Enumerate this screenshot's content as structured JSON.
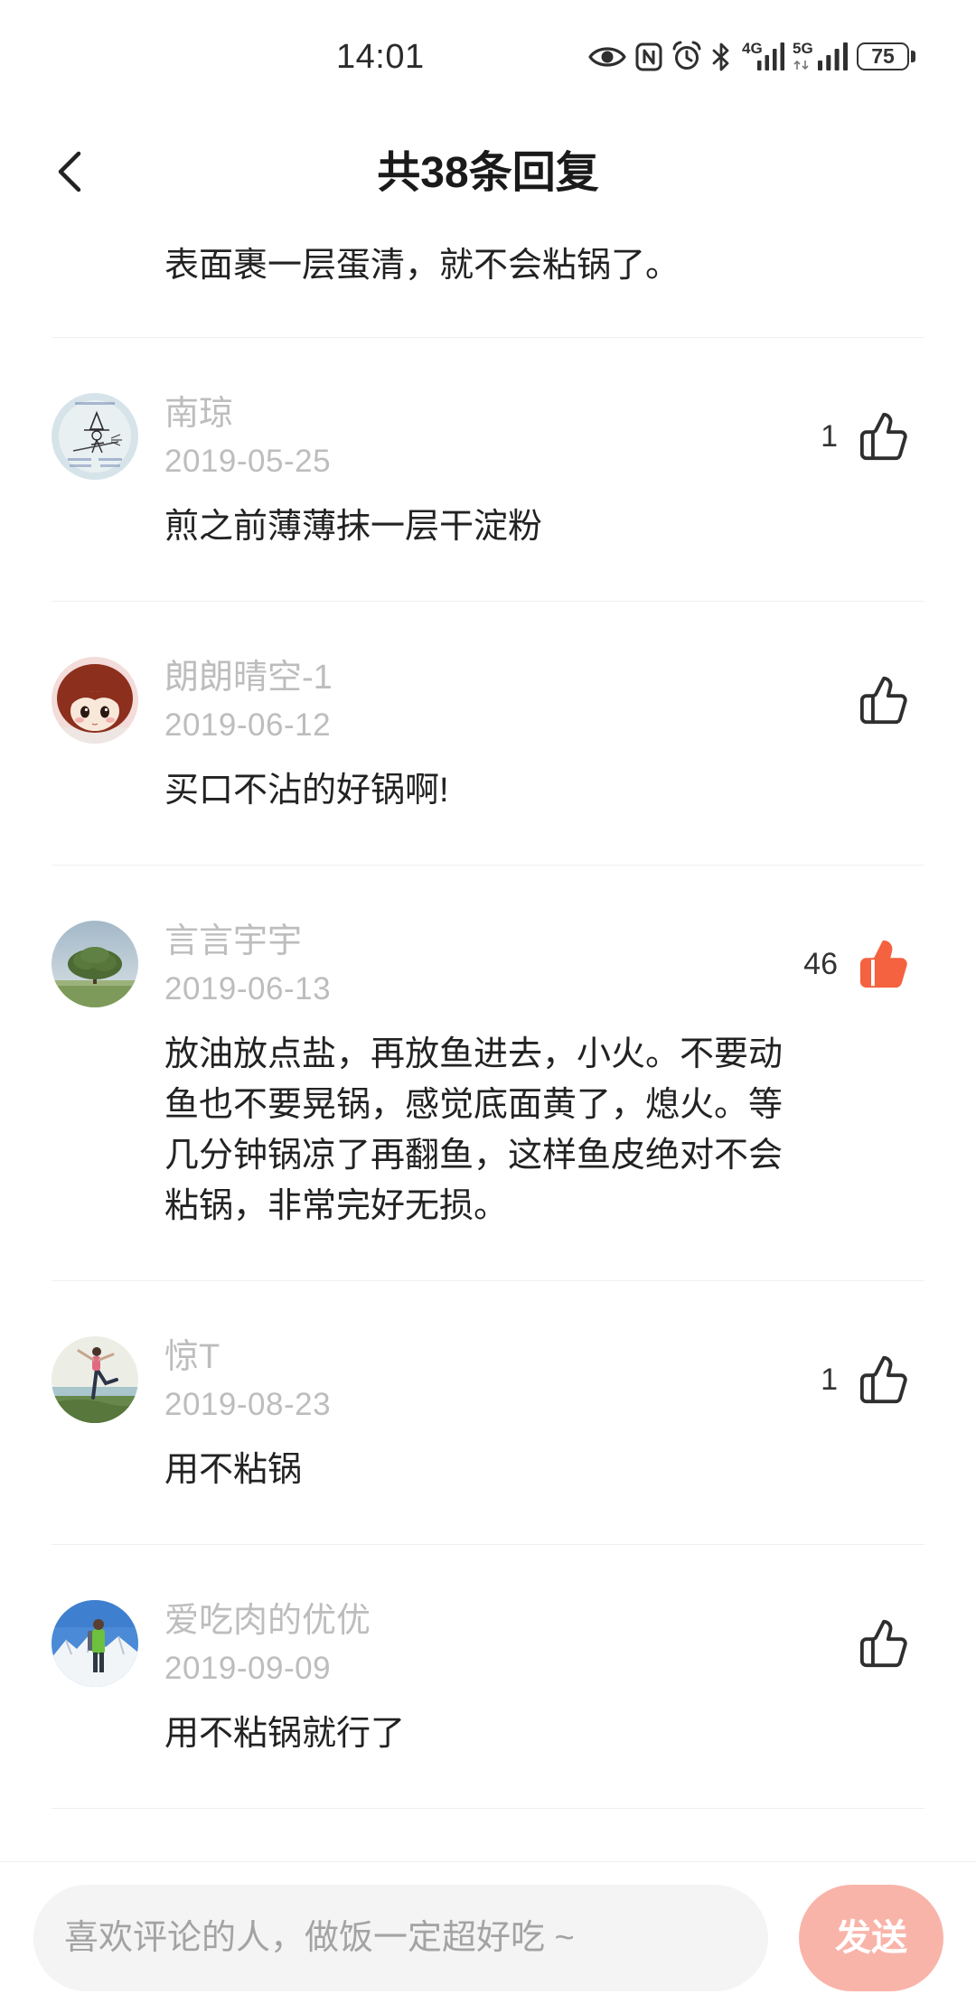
{
  "status_bar": {
    "time": "14:01",
    "network_1": "4G",
    "network_2": "5G",
    "battery_level": "75",
    "icons": [
      "eye-icon",
      "nfc-icon",
      "alarm-icon",
      "bluetooth-icon",
      "signal-4g-icon",
      "signal-5g-icon",
      "battery-icon"
    ]
  },
  "header": {
    "title": "共38条回复",
    "back_icon": "chevron-left-icon"
  },
  "partial_reply": {
    "lines": [
      "表面裹一层蛋清，就不会粘锅了。"
    ]
  },
  "comments": [
    {
      "name": "南琼",
      "date": "2019-05-25",
      "like_count": "1",
      "liked": false,
      "lines": [
        "煎之前薄薄抹一层干淀粉"
      ]
    },
    {
      "name": "朗朗晴空-1",
      "date": "2019-06-12",
      "liked": false,
      "lines": [
        "买口不沾的好锅啊!"
      ]
    },
    {
      "name": "言言宇宇",
      "date": "2019-06-13",
      "like_count": "46",
      "liked": true,
      "lines": [
        "放油放点盐，再放鱼进去，小火。不要动",
        "鱼也不要晃锅，感觉底面黄了，熄火。等",
        "几分钟锅凉了再翻鱼，这样鱼皮绝对不会",
        "粘锅，非常完好无损。"
      ]
    },
    {
      "name": "惊T",
      "date": "2019-08-23",
      "like_count": "1",
      "liked": false,
      "lines": [
        "用不粘锅"
      ]
    },
    {
      "name": "爱吃肉的优优",
      "date": "2019-09-09",
      "liked": false,
      "lines": [
        "用不粘锅就行了"
      ]
    }
  ],
  "icons": {
    "like": "thumb-up-icon",
    "avatar": "avatar"
  },
  "composer": {
    "placeholder": "喜欢评论的人，做饭一定超好吃 ~",
    "send_label": "发送"
  },
  "colors": {
    "accent_liked": "#f4623f",
    "send_button": "#f9b4aa",
    "meta_text": "#bdbdbd",
    "body_text": "#222222",
    "divider": "#efefef"
  }
}
